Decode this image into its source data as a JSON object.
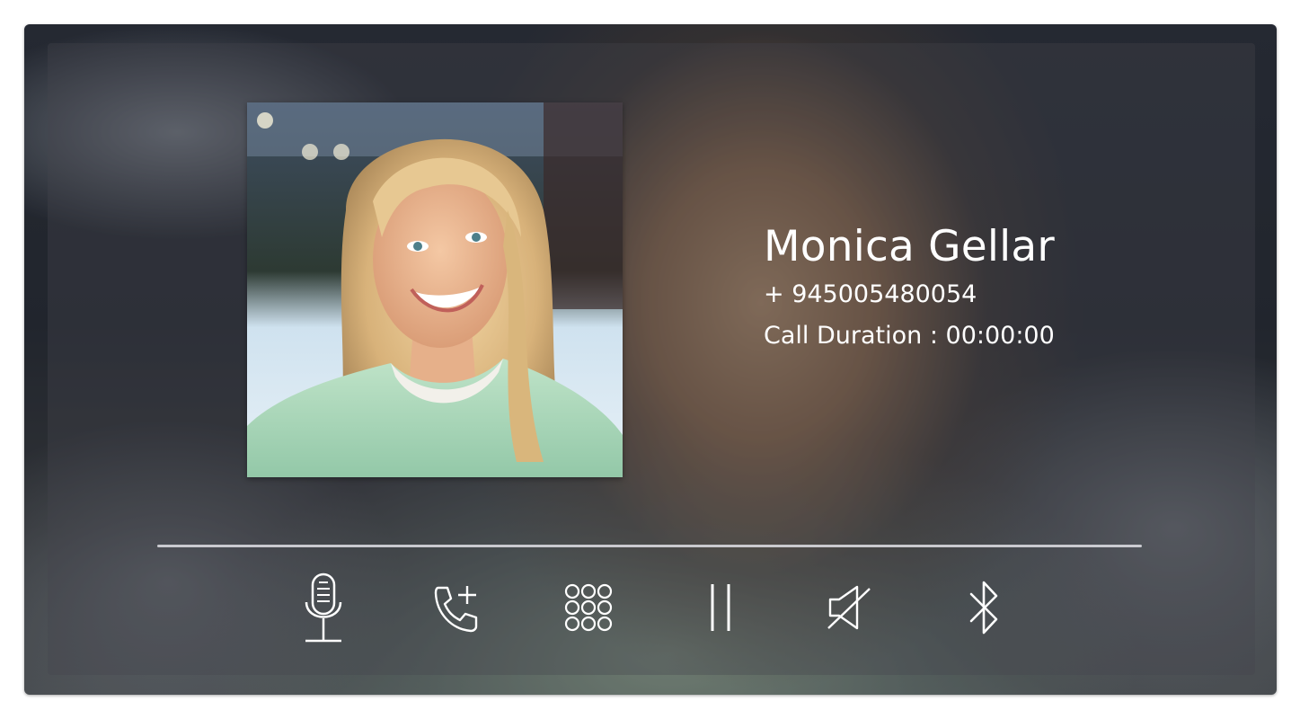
{
  "contact": {
    "name": "Monica Gellar",
    "number": "+ 945005480054",
    "call_duration_label": "Call Duration : 00:00:00"
  },
  "controls": [
    {
      "name": "microphone",
      "icon": "microphone-icon"
    },
    {
      "name": "add-call",
      "icon": "phone-plus-icon"
    },
    {
      "name": "keypad",
      "icon": "dialpad-icon"
    },
    {
      "name": "hold",
      "icon": "pause-icon"
    },
    {
      "name": "mute-speaker",
      "icon": "speaker-muted-icon"
    },
    {
      "name": "bluetooth",
      "icon": "bluetooth-icon"
    }
  ],
  "colors": {
    "text": "#ffffff",
    "divider": "#e1e1e6"
  }
}
